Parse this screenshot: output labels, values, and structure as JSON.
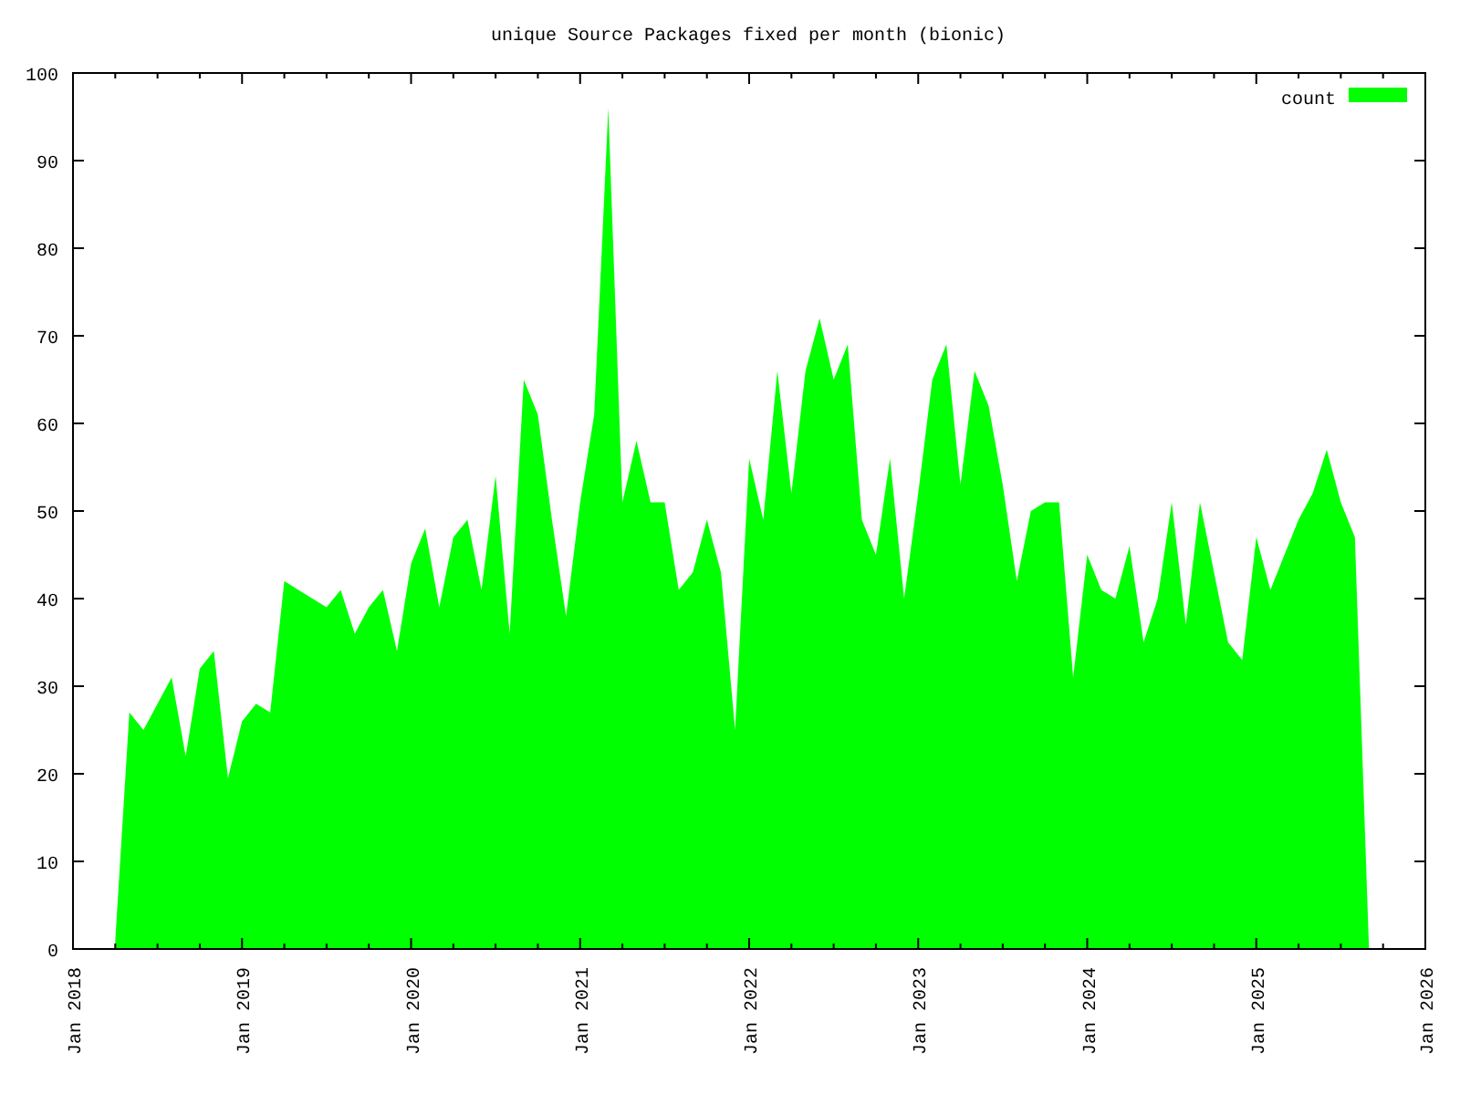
{
  "chart": {
    "chart_data": {
      "type": "area",
      "title": "unique Source Packages fixed per month (bionic)",
      "categories": [
        "Jan 2018",
        null,
        null,
        null,
        null,
        null,
        null,
        null,
        null,
        null,
        null,
        null,
        "Jan 2019",
        null,
        null,
        null,
        null,
        null,
        null,
        null,
        null,
        null,
        null,
        null,
        "Jan 2020",
        null,
        null,
        null,
        null,
        null,
        null,
        null,
        null,
        null,
        null,
        null,
        "Jan 2021",
        null,
        null,
        null,
        null,
        null,
        null,
        null,
        null,
        null,
        null,
        null,
        "Jan 2022",
        null,
        null,
        null,
        null,
        null,
        null,
        null,
        null,
        null,
        null,
        null,
        "Jan 2023",
        null,
        null,
        null,
        null,
        null,
        null,
        null,
        null,
        null,
        null,
        null,
        "Jan 2024",
        null,
        null,
        null,
        null,
        null,
        null,
        null,
        null,
        null,
        null,
        null,
        "Jan 2025",
        null,
        null,
        null,
        null,
        null,
        null,
        null,
        null,
        null,
        null,
        null,
        "Jan 2026"
      ],
      "series": [
        {
          "name": "count",
          "color": "#00ff00",
          "values": [
            null,
            null,
            null,
            1,
            27,
            25,
            28,
            31,
            22,
            32,
            34,
            19.5,
            26,
            28,
            27,
            42,
            41,
            40,
            39,
            41,
            36,
            39,
            41,
            34,
            44,
            48,
            39,
            47,
            49,
            41,
            54,
            36,
            65,
            61,
            49,
            38,
            51,
            61,
            96,
            51,
            58,
            51,
            51,
            41,
            43,
            49,
            43,
            25,
            56,
            49,
            66,
            52,
            66,
            72,
            65,
            69,
            49,
            45,
            56,
            40,
            52,
            65,
            69,
            53,
            66,
            62,
            53,
            42,
            50,
            51,
            51,
            31,
            45,
            41,
            40,
            46,
            35,
            40,
            51,
            37,
            51,
            43,
            35,
            33,
            47,
            41,
            45,
            49,
            52,
            57,
            51,
            47,
            0,
            null,
            null,
            null,
            null
          ]
        }
      ],
      "ylim": [
        0,
        100
      ],
      "yticks": [
        0,
        10,
        20,
        30,
        40,
        50,
        60,
        70,
        80,
        90,
        100
      ]
    }
  }
}
